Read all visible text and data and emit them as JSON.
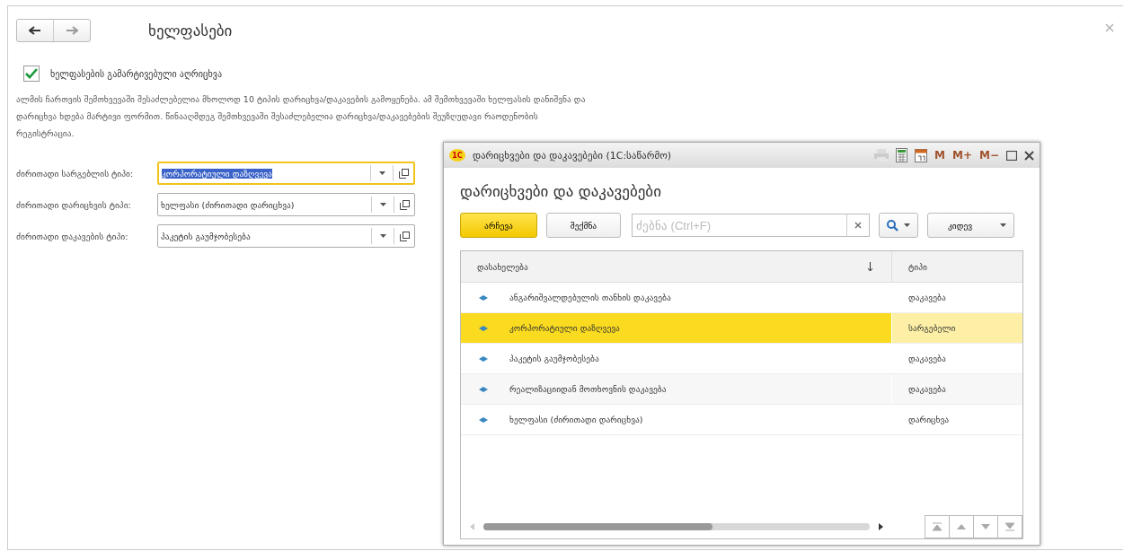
{
  "form": {
    "title": "ხელფასები",
    "checkbox": {
      "label": "ხელფასების გამარტივებული აღრიცხვა",
      "checked": true
    },
    "description": "ალმის ჩართვის შემთხვევაში შესაძლებელია მხოლოდ 10 ტიპის დარიცხვა/დაკავების გამოყენება. ამ შემთხვევაში ხელფასის დანიშვნა და დარიცხვა ხდება მარტივი ფორმით. წინააღმდეგ შემთხვევაში შესაძლებელია დარიცხვა/დაკავებების შეუზღუდავი რაოდენობის რეგისტრაცია.",
    "fields": [
      {
        "label": "ძირითადი სარგებლის ტიპი:",
        "value": "კორპორატიული დაზღვევა",
        "focused": true,
        "text_selected": true
      },
      {
        "label": "ძირითადი დარიცხვის ტიპი:",
        "value": "ხელფასი (ძირითადი დარიცხვა)",
        "focused": false,
        "text_selected": false
      },
      {
        "label": "ძირითადი დაკავების ტიპი:",
        "value": "პაკეტის გაუმჯობესება",
        "focused": false,
        "text_selected": false
      }
    ]
  },
  "dialog": {
    "logo": "1С",
    "window_title": "დარიცხვები და დაკავებები (1C:საწარმო)",
    "memory_buttons": [
      "M",
      "M+",
      "M−"
    ],
    "heading": "დარიცხვები და დაკავებები",
    "select_button": "არჩევა",
    "create_button": "შექმნა",
    "search": {
      "placeholder": "ძებნა (Ctrl+F)"
    },
    "more_button": "კიდევ",
    "table": {
      "columns": [
        "დასახელება",
        "ტიპი"
      ],
      "rows": [
        {
          "name": "ანგარიშვალდებულის თანხის დაკავება",
          "type": "დაკავება",
          "selected": false
        },
        {
          "name": "კორპორატიული დაზღვევა",
          "type": "სარგებელი",
          "selected": true
        },
        {
          "name": "პაკეტის გაუმჯობესება",
          "type": "დაკავება",
          "selected": false
        },
        {
          "name": "რეალიზაციიდან მოთხოვნის დაკავება",
          "type": "დაკავება",
          "selected": false
        },
        {
          "name": "ხელფასი (ძირითადი დარიცხვა)",
          "type": "დარიცხვა",
          "selected": false
        }
      ]
    }
  }
}
